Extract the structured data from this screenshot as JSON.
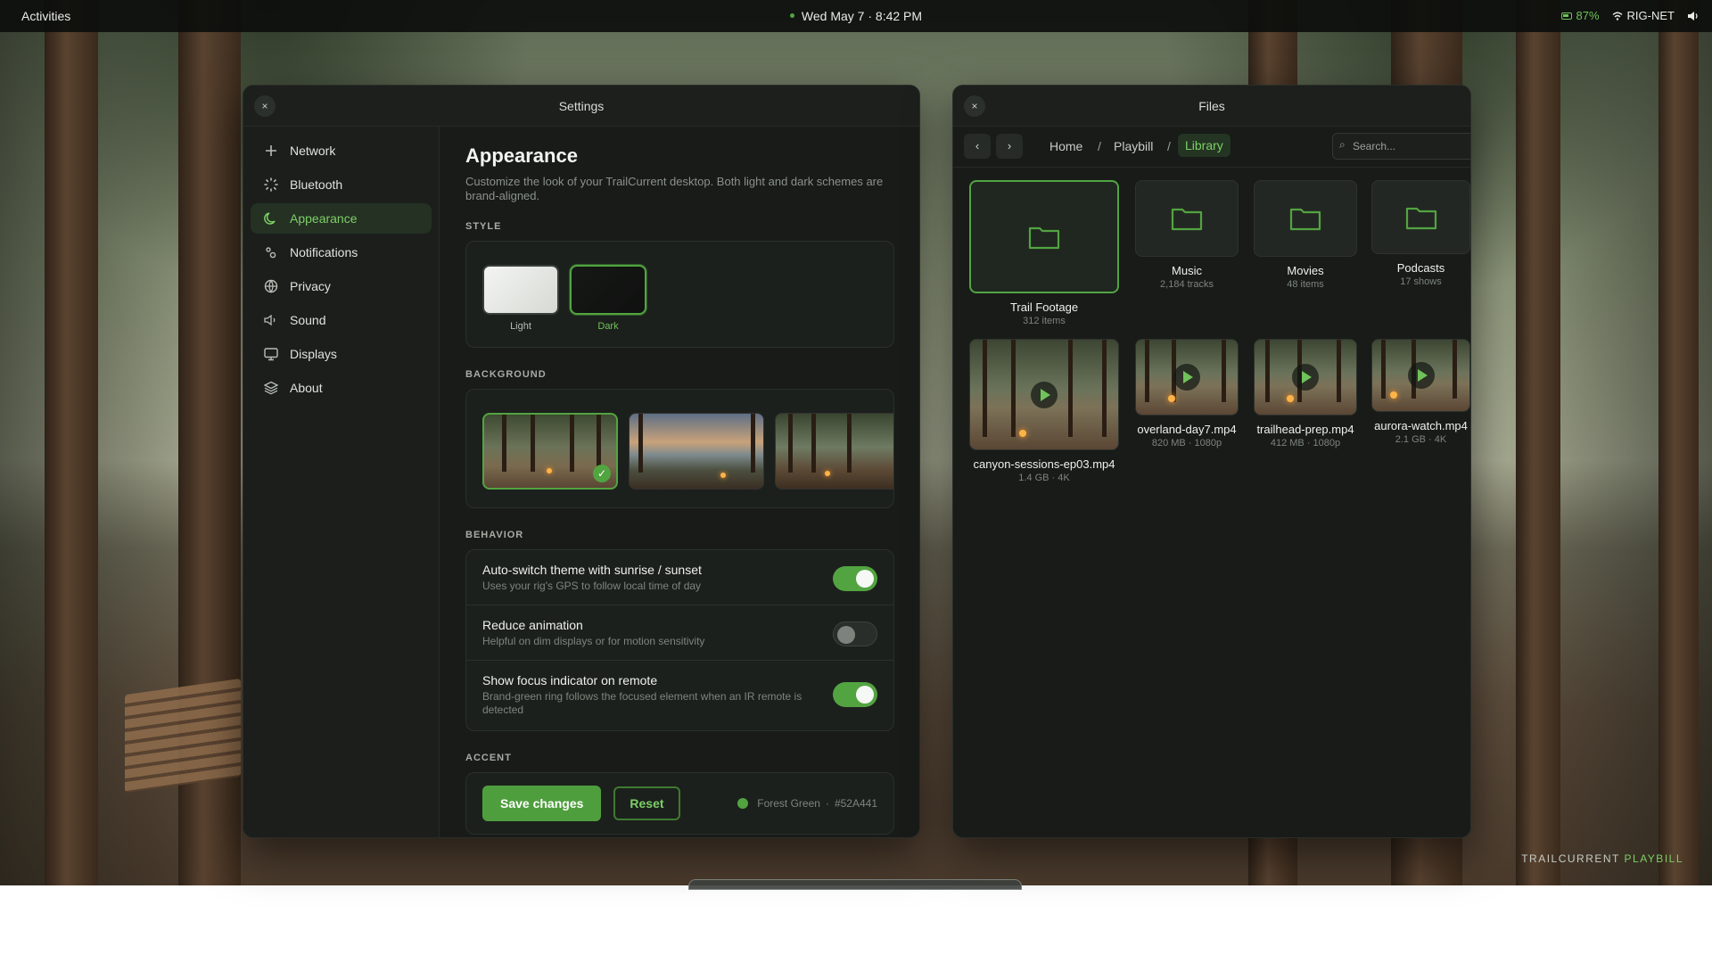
{
  "topbar": {
    "activities": "Activities",
    "clock": "Wed May 7 · 8:42 PM",
    "battery": "87%",
    "network": "RIG-NET"
  },
  "settings": {
    "title": "Settings",
    "close": "×",
    "nav": [
      {
        "label": "Network",
        "icon": "plus-icon"
      },
      {
        "label": "Bluetooth",
        "icon": "bluetooth-icon"
      },
      {
        "label": "Appearance",
        "icon": "moon-icon"
      },
      {
        "label": "Notifications",
        "icon": "bell-icon"
      },
      {
        "label": "Privacy",
        "icon": "globe-icon"
      },
      {
        "label": "Sound",
        "icon": "speaker-icon"
      },
      {
        "label": "Displays",
        "icon": "monitor-icon"
      },
      {
        "label": "About",
        "icon": "layers-icon"
      }
    ],
    "active_nav": "Appearance",
    "heading": "Appearance",
    "description": "Customize the look of your TrailCurrent desktop. Both light and dark schemes are brand-aligned.",
    "style_label": "STYLE",
    "styles": [
      {
        "label": "Light"
      },
      {
        "label": "Dark"
      }
    ],
    "selected_style": "Dark",
    "background_label": "BACKGROUND",
    "behavior_label": "BEHAVIOR",
    "behavior": [
      {
        "title": "Auto-switch theme with sunrise / sunset",
        "subtitle": "Uses your rig's GPS to follow local time of day",
        "on": true
      },
      {
        "title": "Reduce animation",
        "subtitle": "Helpful on dim displays or for motion sensitivity",
        "on": false
      },
      {
        "title": "Show focus indicator on remote",
        "subtitle": "Brand-green ring follows the focused element when an IR remote is detected",
        "on": true
      }
    ],
    "accent_label": "ACCENT",
    "save_label": "Save changes",
    "reset_label": "Reset",
    "accent_name": "Forest Green",
    "accent_sep": "·",
    "accent_hex": "#52A441"
  },
  "files": {
    "title": "Files",
    "close": "×",
    "back": "‹",
    "forward": "›",
    "breadcrumb": [
      "Home",
      "Playbill",
      "Library"
    ],
    "crumb_sep": "/",
    "search_placeholder": "Search...",
    "folders": [
      {
        "name": "Trail Footage",
        "meta": "312 items"
      },
      {
        "name": "Music",
        "meta": "2,184 tracks"
      },
      {
        "name": "Movies",
        "meta": "48 items"
      },
      {
        "name": "Podcasts",
        "meta": "17 shows"
      }
    ],
    "videos": [
      {
        "name": "canyon-sessions-ep03.mp4",
        "meta": "1.4 GB · 4K"
      },
      {
        "name": "overland-day7.mp4",
        "meta": "820 MB · 1080p"
      },
      {
        "name": "trailhead-prep.mp4",
        "meta": "412 MB · 1080p"
      },
      {
        "name": "aurora-watch.mp4",
        "meta": "2.1 GB · 4K"
      }
    ]
  },
  "watermark": {
    "brand": "TRAILCURRENT",
    "product": "PLAYBILL"
  },
  "colors": {
    "accent": "#52A441",
    "window_bg": "#181b18"
  }
}
